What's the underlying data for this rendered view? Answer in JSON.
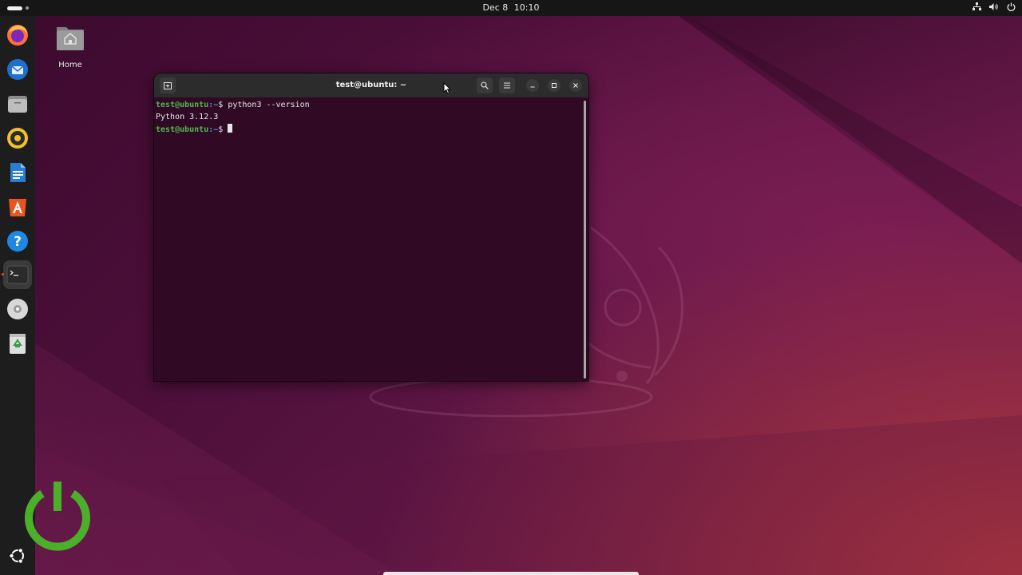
{
  "topbar": {
    "date": "Dec 8",
    "time": "10:10",
    "tray_icons": [
      "network-icon",
      "volume-icon",
      "power-icon"
    ]
  },
  "dock": {
    "items": [
      {
        "name": "firefox",
        "icon": "firefox-icon"
      },
      {
        "name": "thunderbird",
        "icon": "thunderbird-icon"
      },
      {
        "name": "files",
        "icon": "files-icon"
      },
      {
        "name": "rhythmbox",
        "icon": "rhythmbox-icon"
      },
      {
        "name": "libreoffice-writer",
        "icon": "writer-icon"
      },
      {
        "name": "app-center",
        "icon": "app-center-icon"
      },
      {
        "name": "help",
        "icon": "help-icon"
      },
      {
        "name": "terminal",
        "icon": "terminal-icon",
        "active": true
      },
      {
        "name": "disc",
        "icon": "disc-icon"
      },
      {
        "name": "trash",
        "icon": "trash-icon"
      }
    ],
    "apps_button_icon": "ubuntu-logo-icon"
  },
  "desktop": {
    "home_label": "Home"
  },
  "terminal": {
    "title": "test@ubuntu: ~",
    "lines": [
      {
        "user": "test@ubuntu",
        "path": ":~",
        "symbol": "$",
        "command": " python3 --version"
      },
      {
        "output": "Python 3.12.3"
      },
      {
        "user": "test@ubuntu",
        "path": ":~",
        "symbol": "$",
        "command": " "
      }
    ]
  },
  "colors": {
    "terminal_bg": "#300a24",
    "prompt_user": "#4fb84f",
    "prompt_path": "#5a8ed6",
    "accent": "#e95420"
  }
}
